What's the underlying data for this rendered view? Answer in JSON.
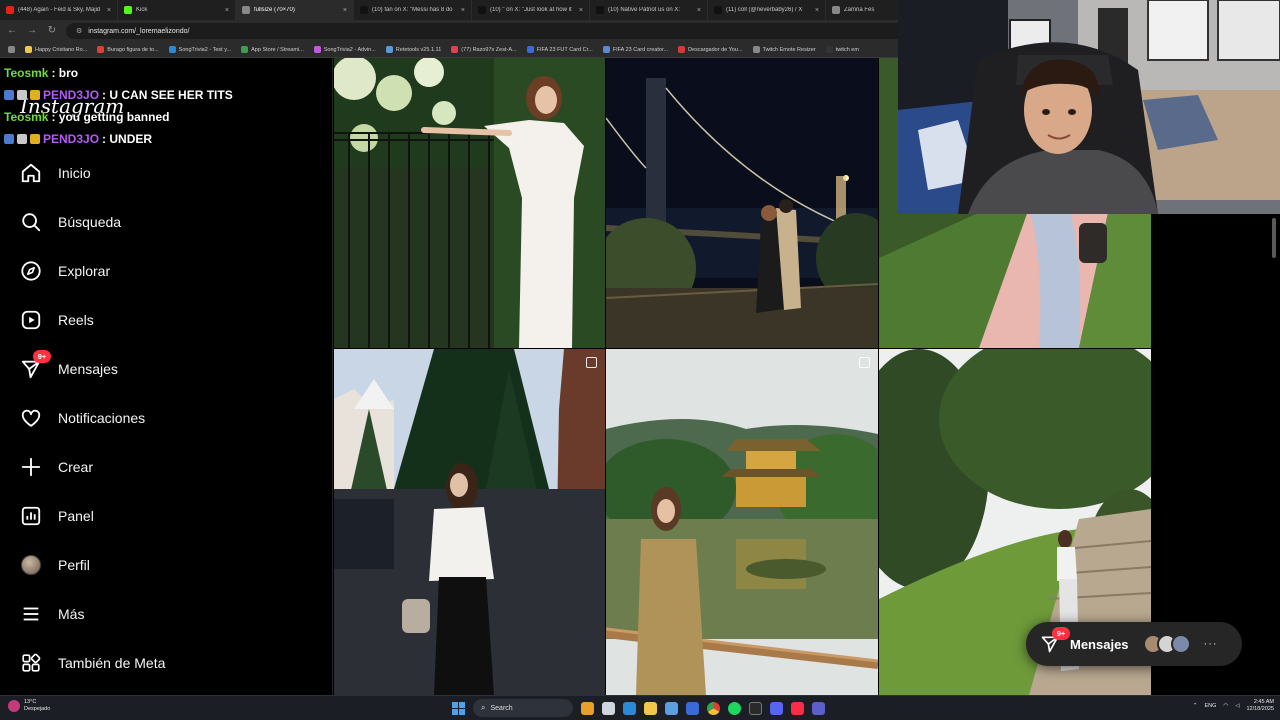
{
  "browser": {
    "tabs": [
      {
        "label": "(448) Again - Feid & Sky, Majid",
        "color": "#e62117"
      },
      {
        "label": "Kick",
        "color": "#53fc18"
      },
      {
        "label": "fullsize (70×70)",
        "color": "#888888"
      },
      {
        "label": "(10) fan on X: \"Messi has 8 do",
        "color": "#111111"
      },
      {
        "label": "(10) \" on X: \"Just look at how it",
        "color": "#111111"
      },
      {
        "label": "(10) Native Patriot us on X:",
        "color": "#111111"
      },
      {
        "label": "(11) coll (@neverbaby26) / X",
        "color": "#111111"
      },
      {
        "label": "Zamna Fes",
        "color": "#888888"
      }
    ],
    "url": "instagram.com/_loremaelizondo/",
    "bookmarks": [
      "Happy Cristiano Ro...",
      "Burago figura de to...",
      "SongTrivia2 - Test y...",
      "App Store / Streami...",
      "SongTrivia2 - Advin...",
      "Retetools v25.1.11",
      "(77) Razo97s Zest-A...",
      "FIFA 23 FUT Card Cr...",
      "FIFA 23 Card creator...",
      "Descargador de You...",
      "Twitch Emote Resizer",
      "twitch em"
    ]
  },
  "chat": {
    "lines": [
      {
        "user": "Teosmk",
        "msg": ": bro",
        "color": "#6fdc3a",
        "badges": false
      },
      {
        "user": "PEND3JO",
        "msg": ": U CAN SEE HER TITS",
        "color": "#b25bf5",
        "badges": true
      },
      {
        "user": "Teosmk",
        "msg": ": you getting banned",
        "color": "#6fdc3a",
        "badges": false
      },
      {
        "user": "PEND3JO",
        "msg": ": UNDER",
        "color": "#b25bf5",
        "badges": true
      }
    ]
  },
  "instagram": {
    "logo": "Instagram",
    "nav": [
      {
        "label": "Inicio",
        "icon": "home-icon"
      },
      {
        "label": "Búsqueda",
        "icon": "search-icon"
      },
      {
        "label": "Explorar",
        "icon": "compass-icon"
      },
      {
        "label": "Reels",
        "icon": "reels-icon"
      },
      {
        "label": "Mensajes",
        "icon": "messenger-icon",
        "badge": "9+"
      },
      {
        "label": "Notificaciones",
        "icon": "heart-icon"
      },
      {
        "label": "Crear",
        "icon": "plus-icon"
      },
      {
        "label": "Panel",
        "icon": "chart-icon"
      },
      {
        "label": "Perfil",
        "icon": "avatar-icon"
      },
      {
        "label": "Más",
        "icon": "menu-icon"
      },
      {
        "label": "También de Meta",
        "icon": "meta-grid-icon"
      }
    ],
    "messages_pill": {
      "label": "Mensajes",
      "badge": "9+"
    }
  },
  "taskbar": {
    "temp": "13°C",
    "weather": "Despejado",
    "search": "Search",
    "lang": "ENG",
    "time": "2:45 AM",
    "date": "12/18/2025"
  },
  "colors": {
    "accent_badge": "#ff3040",
    "pill_bg": "#262626",
    "sidebar_bg": "#000000"
  }
}
